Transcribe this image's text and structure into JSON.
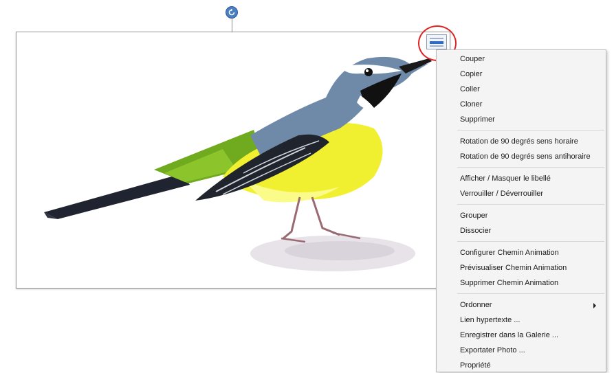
{
  "canvas": {
    "rotate_icon": "rotate-icon",
    "menu_handle_icon": "menu-handle-icon"
  },
  "context_menu": {
    "groups": [
      {
        "items": [
          {
            "label": "Couper"
          },
          {
            "label": "Copier"
          },
          {
            "label": "Coller"
          },
          {
            "label": "Cloner"
          },
          {
            "label": "Supprimer"
          }
        ]
      },
      {
        "items": [
          {
            "label": "Rotation de 90 degrés sens horaire"
          },
          {
            "label": "Rotation de 90 degrés sens antihoraire"
          }
        ]
      },
      {
        "items": [
          {
            "label": "Afficher / Masquer le libellé"
          },
          {
            "label": "Verrouiller / Déverrouiller"
          }
        ]
      },
      {
        "items": [
          {
            "label": "Grouper"
          },
          {
            "label": "Dissocier"
          }
        ]
      },
      {
        "items": [
          {
            "label": "Configurer Chemin Animation"
          },
          {
            "label": "Prévisualiser Chemin Animation"
          },
          {
            "label": "Supprimer Chemin Animation"
          }
        ]
      },
      {
        "items": [
          {
            "label": "Ordonner",
            "submenu": true
          },
          {
            "label": "Lien hypertexte ..."
          },
          {
            "label": "Enregistrer dans la Galerie ..."
          },
          {
            "label": "Exportater Photo ..."
          },
          {
            "label": "Propriété"
          }
        ]
      }
    ]
  },
  "colors": {
    "highlight": "#e02424",
    "accent": "#2b6cc4"
  }
}
